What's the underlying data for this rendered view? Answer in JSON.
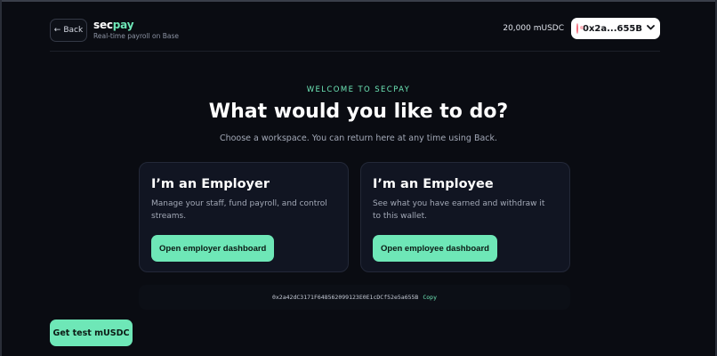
{
  "header": {
    "back_label": "Back",
    "back_arrow": "←",
    "brand_sec": "sec",
    "brand_pay": "pay",
    "tagline": "Real-time payroll on Base",
    "balance": "20,000 mUSDC",
    "wallet_address": "0x2a...655B",
    "wallet_chevron": "chevron-down-icon"
  },
  "hero": {
    "eyebrow": "WELCOME TO SECPAY",
    "title": "What would you like to do?",
    "subtitle": "Choose a workspace. You can return here at any time using Back."
  },
  "cards": {
    "employer": {
      "title": "I’m an Employer",
      "description": "Manage your staff, fund payroll, and control streams.",
      "button": "Open employer dashboard"
    },
    "employee": {
      "title": "I’m an Employee",
      "description": "See what you have earned and withdraw it to this wallet.",
      "button": "Open employee dashboard"
    }
  },
  "footer": {
    "full_address": "0x2a42dC3171F648562099123E0E1cDCf52e5a655B",
    "copy_label": "Copy",
    "test_button": "Get test mUSDC"
  },
  "colors": {
    "accent": "#6ee7b7",
    "background": "#0a0c12",
    "card": "#111522",
    "avatar": "#f26b7a"
  }
}
